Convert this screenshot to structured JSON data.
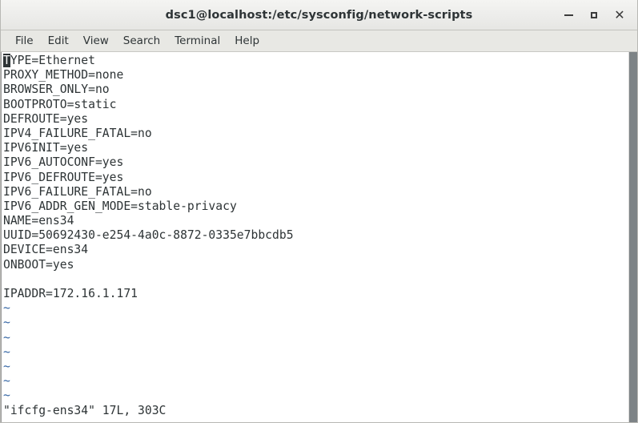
{
  "window": {
    "title": "dsc1@localhost:/etc/sysconfig/network-scripts",
    "controls": [
      {
        "name": "minimize",
        "glyph": "_"
      },
      {
        "name": "maximize",
        "glyph": "□"
      },
      {
        "name": "close",
        "glyph": "✕"
      }
    ]
  },
  "menubar": {
    "items": [
      {
        "label": "File"
      },
      {
        "label": "Edit"
      },
      {
        "label": "View"
      },
      {
        "label": "Search"
      },
      {
        "label": "Terminal"
      },
      {
        "label": "Help"
      }
    ]
  },
  "terminal": {
    "cursor_char": "T",
    "first_line_rest": "YPE=Ethernet",
    "lines": [
      "PROXY_METHOD=none",
      "BROWSER_ONLY=no",
      "BOOTPROTO=static",
      "DEFROUTE=yes",
      "IPV4_FAILURE_FATAL=no",
      "IPV6INIT=yes",
      "IPV6_AUTOCONF=yes",
      "IPV6_DEFROUTE=yes",
      "IPV6_FAILURE_FATAL=no",
      "IPV6_ADDR_GEN_MODE=stable-privacy",
      "NAME=ens34",
      "UUID=50692430-e254-4a0c-8872-0335e7bbcdb5",
      "DEVICE=ens34",
      "ONBOOT=yes",
      "",
      "IPADDR=172.16.1.171"
    ],
    "empty_markers": [
      "~",
      "~",
      "~",
      "~",
      "~",
      "~",
      "~"
    ],
    "status_line": "\"ifcfg-ens34\" 17L, 303C"
  },
  "colors": {
    "text": "#2e3436",
    "tilde": "#3465a4",
    "terminal_bg": "#ffffff",
    "titlebar_bg": "#ececea",
    "menubar_bg": "#e8e8e4",
    "scrollbar": "#7d8386"
  }
}
